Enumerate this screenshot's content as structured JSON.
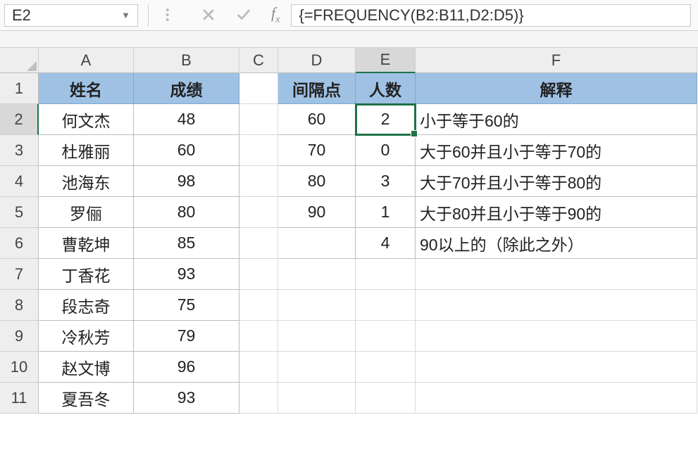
{
  "nameBox": "E2",
  "formula": "{=FREQUENCY(B2:B11,D2:D5)}",
  "columns": [
    "A",
    "B",
    "C",
    "D",
    "E",
    "F"
  ],
  "rows": [
    "1",
    "2",
    "3",
    "4",
    "5",
    "6",
    "7",
    "8",
    "9",
    "10",
    "11"
  ],
  "headers": {
    "A": "姓名",
    "B": "成绩",
    "D": "间隔点",
    "E": "人数",
    "F": "解释"
  },
  "tableAB": [
    {
      "name": "何文杰",
      "score": "48"
    },
    {
      "name": "杜雅丽",
      "score": "60"
    },
    {
      "name": "池海东",
      "score": "98"
    },
    {
      "name": "罗俪",
      "score": "80"
    },
    {
      "name": "曹乾坤",
      "score": "85"
    },
    {
      "name": "丁香花",
      "score": "93"
    },
    {
      "name": "段志奇",
      "score": "75"
    },
    {
      "name": "冷秋芳",
      "score": "79"
    },
    {
      "name": "赵文博",
      "score": "96"
    },
    {
      "name": "夏吾冬",
      "score": "93"
    }
  ],
  "tableDEF": [
    {
      "d": "60",
      "e": "2",
      "f": "小于等于60的"
    },
    {
      "d": "70",
      "e": "0",
      "f": "大于60并且小于等于70的"
    },
    {
      "d": "80",
      "e": "3",
      "f": "大于70并且小于等于80的"
    },
    {
      "d": "90",
      "e": "1",
      "f": "大于80并且小于等于90的"
    },
    {
      "d": "",
      "e": "4",
      "f": "90以上的（除此之外）"
    }
  ],
  "activeCell": {
    "col": "E",
    "row": "2"
  }
}
